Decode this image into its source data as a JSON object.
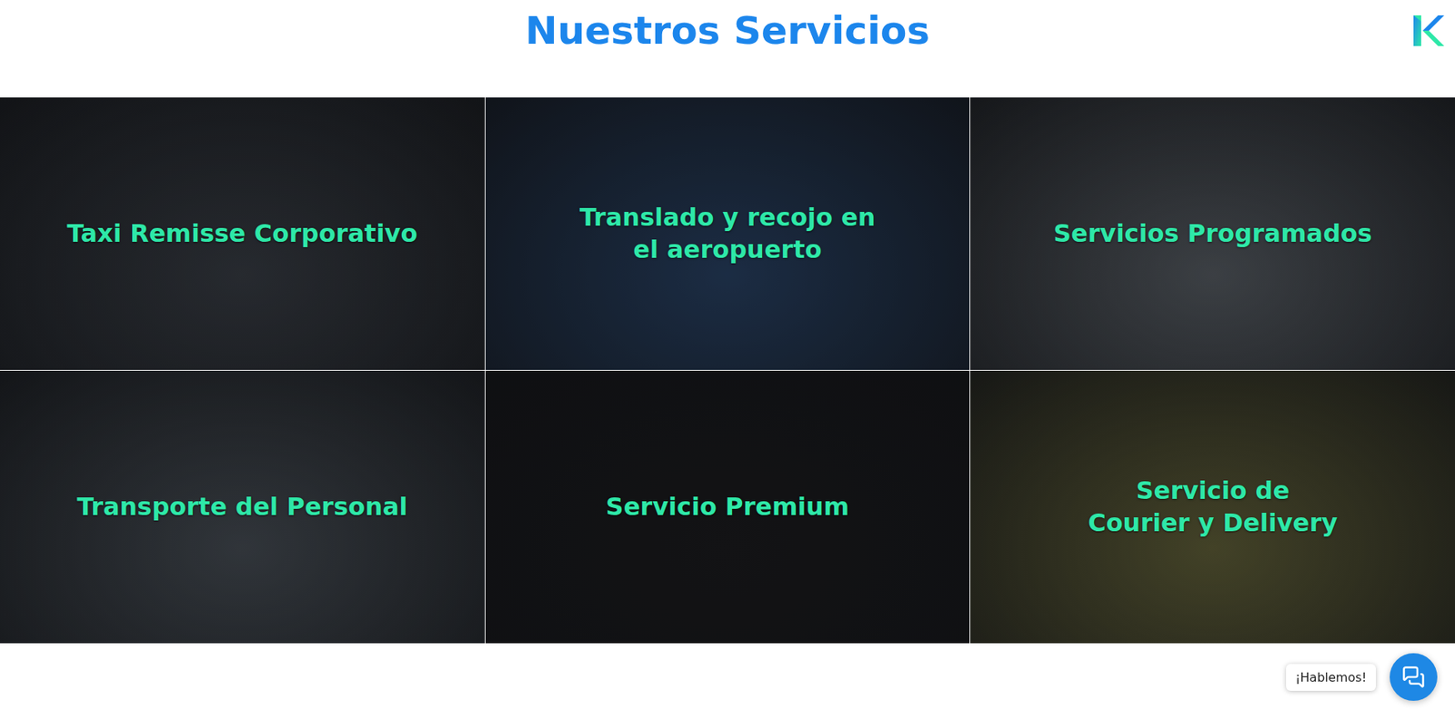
{
  "page": {
    "title": "Nuestros Servicios"
  },
  "services": [
    {
      "lines": [
        "Taxi Remisse Corporativo"
      ],
      "color": "#3b4048"
    },
    {
      "lines": [
        "Translado y recojo en",
        "el aeropuerto"
      ],
      "color": "#2a4468"
    },
    {
      "lines": [
        "Servicios Programados"
      ],
      "color": "#5b6168"
    },
    {
      "lines": [
        "Transporte del Personal"
      ],
      "color": "#4a5159"
    },
    {
      "lines": [
        "Servicio Premium"
      ],
      "color": "#1d1d20"
    },
    {
      "lines": [
        "Servicio de",
        "Courier y Delivery"
      ],
      "color": "#66653c"
    }
  ],
  "chat": {
    "label": "¡Hablemos!"
  }
}
